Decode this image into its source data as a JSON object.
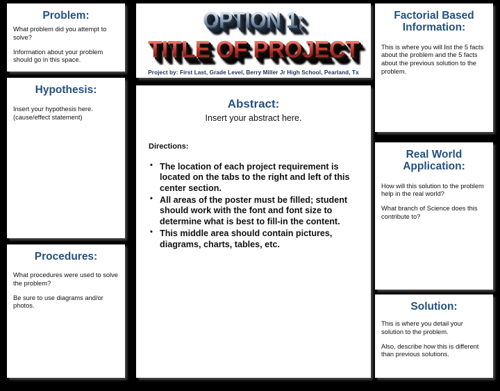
{
  "poster": {
    "background_color": "#000000",
    "panel_color": "#ffffff",
    "heading_color": "#24517e",
    "body_color": "#111111"
  },
  "title_panel": {
    "option_line": "OPTION 1:",
    "title_line": "TITLE OF PROJECT",
    "byline": "Project by: First Last, Grade Level, Berry Miller Jr High School, Pearland, Tx",
    "option_color": "#7e94ad",
    "title_color": "#c63a2e",
    "byline_color": "#1b3358"
  },
  "left_column": {
    "problem": {
      "heading": "Problem:",
      "paragraphs": [
        "What problem did you attempt to solve?",
        "Information about your problem should go in this space."
      ]
    },
    "hypothesis": {
      "heading": "Hypothesis:",
      "paragraphs": [
        "Insert your hypothesis here. (cause/effect statement)"
      ]
    },
    "procedures": {
      "heading": "Procedures:",
      "paragraphs": [
        "What procedures were used to solve the problem?",
        "Be sure to use diagrams and/or photos."
      ]
    }
  },
  "center_column": {
    "abstract": {
      "heading": "Abstract:",
      "subtext": "Insert your abstract here.",
      "directions_label": "Directions:",
      "directions": [
        "The location of each project requirement is located on the tabs to the right and left of this center section.",
        "All areas of the poster must be filled; student should work with the font and font size to determine what is best to fill-in the content.",
        "This middle area should contain pictures, diagrams, charts, tables, etc."
      ]
    }
  },
  "right_column": {
    "factorial": {
      "heading": "Factorial Based Information:",
      "paragraphs": [
        "This is where you will list the 5 facts about the problem and the 5 facts about the previous solution to the problem."
      ]
    },
    "realworld": {
      "heading": "Real World Application:",
      "paragraphs": [
        "How will this solution to the problem help in the real world?",
        "What branch of Science does this contribute to?"
      ]
    },
    "solution": {
      "heading": "Solution:",
      "paragraphs": [
        "This is where you detail your solution to the problem.",
        "Also, describe how this is different than previous solutions."
      ]
    }
  }
}
